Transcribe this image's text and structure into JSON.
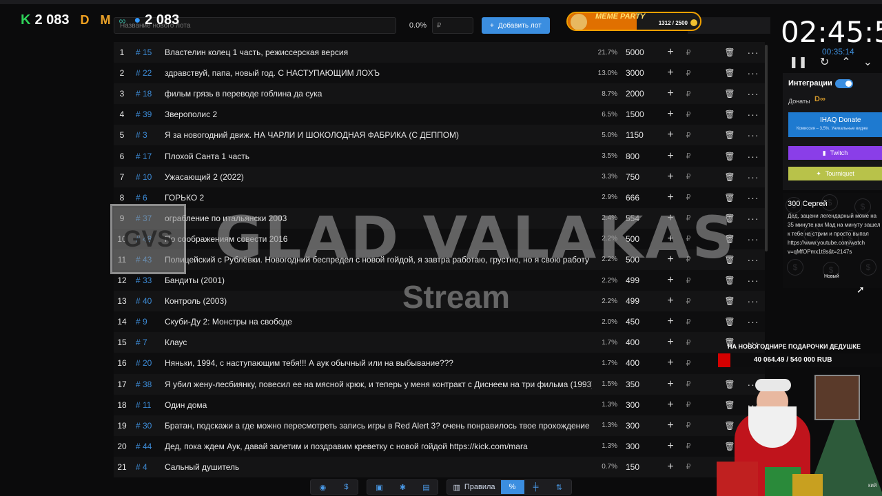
{
  "counters": {
    "kick": "2 083",
    "viewers": "2 083"
  },
  "toolbar": {
    "lot_placeholder": "Название нового лота",
    "percent": "0.0%",
    "currency_placeholder": "₽",
    "add_lot": "Добавить лот"
  },
  "meme_party": {
    "title": "MEME PARTY",
    "progress": "1312 / 2500",
    "fill_fraction": 0.52
  },
  "lots": [
    {
      "idx": "1",
      "id": "# 15",
      "name": "Властелин колец 1 часть, режиссерская версия",
      "pct": "21.7%",
      "amount": "5000"
    },
    {
      "idx": "2",
      "id": "# 22",
      "name": "здравствуй, папа, новый год. С НАСТУПАЮЩИМ ЛОХЪ",
      "pct": "13.0%",
      "amount": "3000"
    },
    {
      "idx": "3",
      "id": "# 18",
      "name": "фильм грязь в переводе гоблина да сука",
      "pct": "8.7%",
      "amount": "2000"
    },
    {
      "idx": "4",
      "id": "# 39",
      "name": "Зверополис 2",
      "pct": "6.5%",
      "amount": "1500"
    },
    {
      "idx": "5",
      "id": "# 3",
      "name": "Я за новогодний движ. НА ЧАРЛИ И ШОКОЛОДНАЯ ФАБРИКА (С ДЕППОМ)",
      "pct": "5.0%",
      "amount": "1150"
    },
    {
      "idx": "6",
      "id": "# 17",
      "name": "Плохой Санта 1 часть",
      "pct": "3.5%",
      "amount": "800"
    },
    {
      "idx": "7",
      "id": "# 10",
      "name": "Ужасающий 2 (2022)",
      "pct": "3.3%",
      "amount": "750"
    },
    {
      "idx": "8",
      "id": "# 6",
      "name": "ГОРЬКО 2",
      "pct": "2.9%",
      "amount": "666"
    },
    {
      "idx": "9",
      "id": "# 37",
      "name": "ограбление по итальянски 2003",
      "pct": "2.4%",
      "amount": "554"
    },
    {
      "idx": "10",
      "id": "# 48",
      "name": "По соображениям совести 2016",
      "pct": "2.2%",
      "amount": "500"
    },
    {
      "idx": "11",
      "id": "# 43",
      "name": "Полицейский с Рублёвки. Новогодний беспредел с новой гойдой, я завтра работаю, грустно, но я свою работу",
      "pct": "2.2%",
      "amount": "500"
    },
    {
      "idx": "12",
      "id": "# 33",
      "name": "Бандиты (2001)",
      "pct": "2.2%",
      "amount": "499"
    },
    {
      "idx": "13",
      "id": "# 40",
      "name": "Контроль (2003)",
      "pct": "2.2%",
      "amount": "499"
    },
    {
      "idx": "14",
      "id": "# 9",
      "name": "Скуби-Ду 2: Монстры на свободе",
      "pct": "2.0%",
      "amount": "450"
    },
    {
      "idx": "15",
      "id": "# 7",
      "name": "Клаус",
      "pct": "1.7%",
      "amount": "400"
    },
    {
      "idx": "16",
      "id": "# 20",
      "name": "Няньки, 1994, с наступающим тебя!!! А аук обычный или на выбывание???",
      "pct": "1.7%",
      "amount": "400"
    },
    {
      "idx": "17",
      "id": "# 38",
      "name": "Я убил жену-лесбиянку, повесил ее на мясной крюк, и теперь у меня контракт с Диснеем на три фильма (1993)",
      "pct": "1.5%",
      "amount": "350"
    },
    {
      "idx": "18",
      "id": "# 11",
      "name": "Один дома",
      "pct": "1.3%",
      "amount": "300"
    },
    {
      "idx": "19",
      "id": "# 30",
      "name": "Братан, подскажи а где можно пересмотреть запись игры в Red Alert 3? очень понравилось твое прохождение",
      "pct": "1.3%",
      "amount": "300"
    },
    {
      "idx": "20",
      "id": "# 44",
      "name": "Дед, пока ждем Аук, давай залетим и поздравим креветку с новой гойдой https://kick.com/mara",
      "pct": "1.3%",
      "amount": "300"
    },
    {
      "idx": "21",
      "id": "# 4",
      "name": "Сальный душитель",
      "pct": "0.7%",
      "amount": "150"
    }
  ],
  "watermark": {
    "logo": "GVS",
    "title": "GLAD VALAKAS",
    "subtitle": "Stream"
  },
  "bottom_bar": {
    "rules": "Правила"
  },
  "timer": {
    "main": "02:45:57",
    "sub": "00:35:14"
  },
  "side": {
    "integrations": "Интеграции",
    "donates": "Донаты",
    "ihaq_title": "IHAQ Donate",
    "ihaq_sub": "Комиссия – 3,5%. Уникальные видже",
    "twitch": "Twitch",
    "tourniquet": "Tourniquet"
  },
  "donation": {
    "header": "300 Сергей",
    "text": "Дед, зацени легендарный моме на 35 минуте как Мад на минуту зашел к тебе на стрим и просто выпал https://www.youtube.com/watch v=qMfOPmx1t8s&t=2147s",
    "badge": "Новый"
  },
  "goal": {
    "title": "НА НОВОГОДНИРЕ ПОДАРОЧКИ ДЕДУШКЕ",
    "progress": "40 064.49 / 540 000 RUB",
    "fraction": 0.074
  },
  "corner": "кий",
  "colors": {
    "accent": "#3b8ee0",
    "id_link": "#3d8cd8",
    "kick_green": "#2ed158",
    "twitch_purple": "#8a3ee8",
    "goal_red": "#d40000"
  }
}
